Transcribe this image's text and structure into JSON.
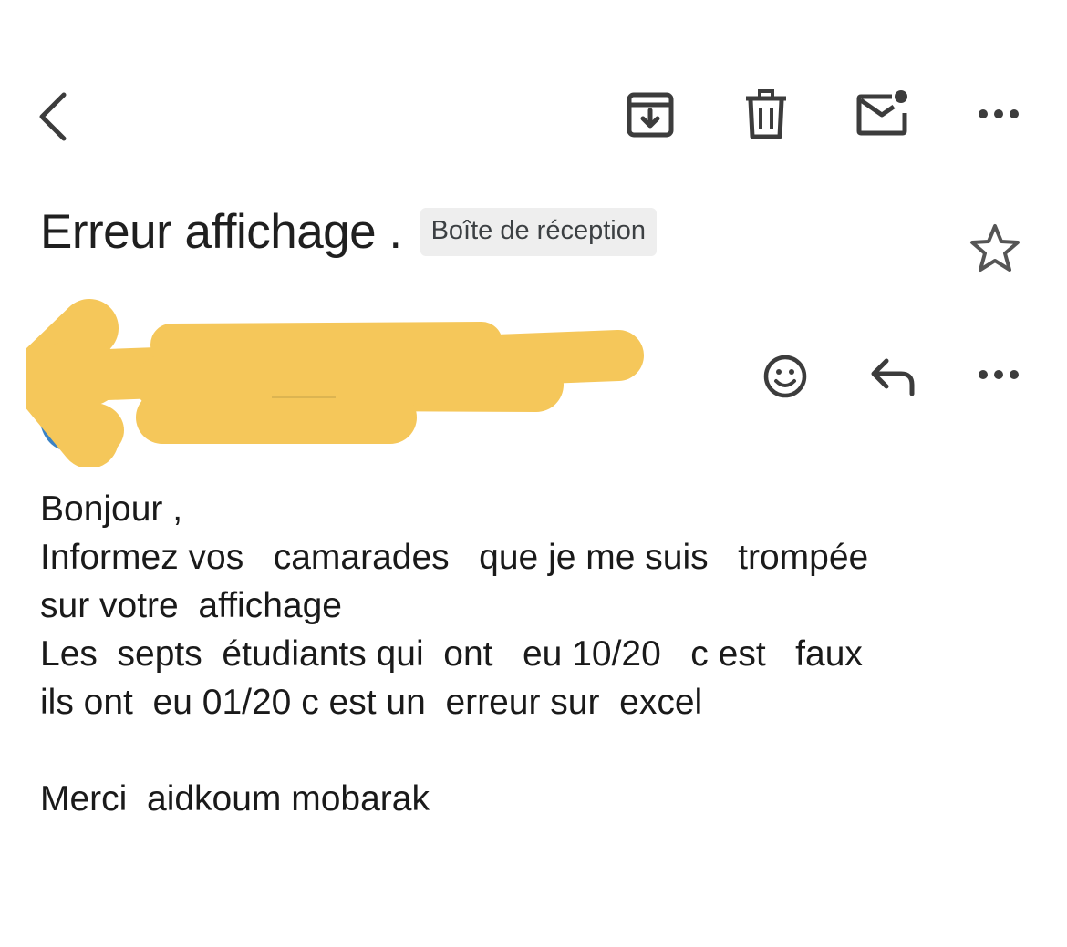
{
  "toolbar": {
    "icons": [
      "back-arrow-icon",
      "archive-icon",
      "trash-icon",
      "mark-unread-icon",
      "more-options-icon"
    ]
  },
  "message": {
    "subject": "Erreur affichage .",
    "label": "Boîte de réception",
    "sender_name": "",
    "sender_detail": "",
    "actions": [
      "star-icon",
      "emoji-reaction-icon",
      "reply-icon",
      "more-options-icon"
    ]
  },
  "body": {
    "lines": [
      "Bonjour ,",
      "Informez vos   camarades   que je me suis   trompée",
      "sur votre  affichage",
      "Les  septs  étudiants qui  ont   eu 10/20   c est   faux",
      "ils ont  eu 01/20 c est un  erreur sur  excel",
      "",
      "Merci  aidkoum mobarak"
    ]
  },
  "colors": {
    "redaction": "#f5c75a",
    "avatar": "#3b82c4",
    "icon": "#444746",
    "chip_bg": "#eeeeee"
  }
}
